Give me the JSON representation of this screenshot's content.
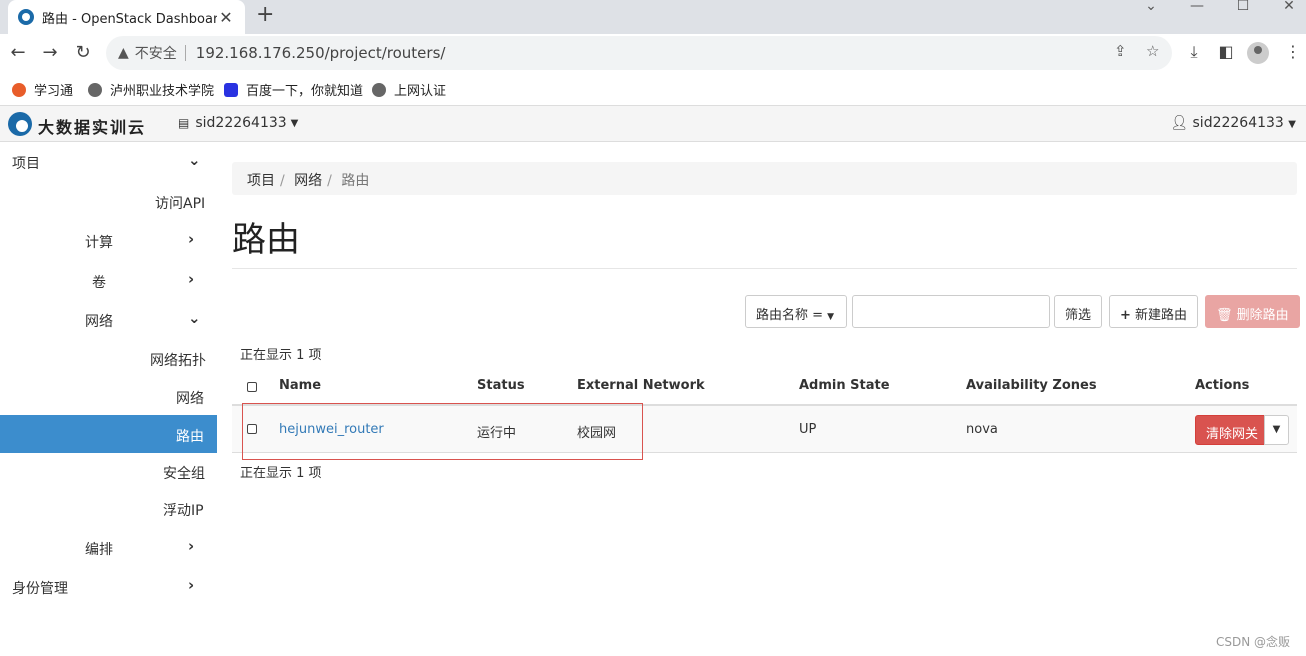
{
  "browser": {
    "tab_title": "路由 - OpenStack Dashboard",
    "tab_close": "✕",
    "new_tab": "+",
    "insecure_label": "不安全",
    "url": "192.168.176.250/project/routers/",
    "bookmarks": [
      "学习通",
      "泸州职业技术学院",
      "百度一下，你就知道",
      "上网认证"
    ]
  },
  "navbar": {
    "brand": "大数据实训云",
    "project": "sid22264133",
    "user": "sid22264133"
  },
  "sidebar": {
    "project": "项目",
    "access_api": "访问API",
    "compute": "计算",
    "volumes": "卷",
    "network": "网络",
    "topology": "网络拓扑",
    "networks": "网络",
    "routers": "路由",
    "security_groups": "安全组",
    "floating_ip": "浮动IP",
    "orchestration": "编排",
    "identity": "身份管理"
  },
  "breadcrumb": [
    "项目",
    "网络",
    "路由"
  ],
  "page_title": "路由",
  "filter": {
    "field": "路由名称 =",
    "filter_button": "筛选",
    "create_button": "新建路由",
    "delete_button": "删除路由"
  },
  "count_text": "正在显示 1 项",
  "table": {
    "headers": [
      "Name",
      "Status",
      "External Network",
      "Admin State",
      "Availability Zones",
      "Actions"
    ],
    "rows": [
      {
        "name": "hejunwei_router",
        "status": "运行中",
        "external_network": "校园网",
        "admin_state": "UP",
        "availability_zone": "nova",
        "action": "清除网关"
      }
    ]
  },
  "watermark": "CSDN @念贩",
  "colors": {
    "sidebar_active": "#3c8dcd",
    "danger": "#d9534f",
    "link": "#337ab7"
  }
}
